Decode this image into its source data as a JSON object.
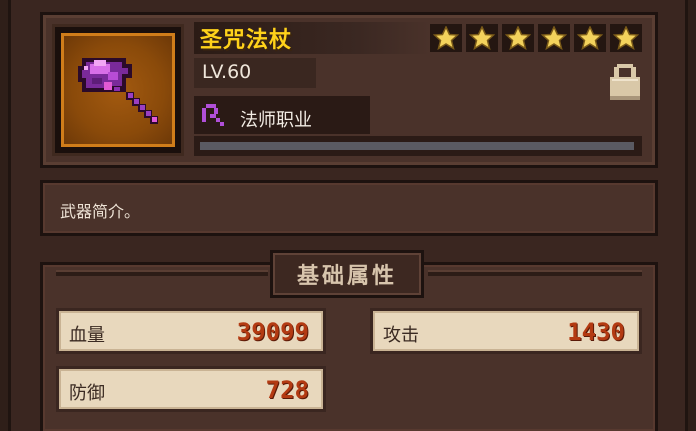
{
  "item": {
    "name": "圣咒法杖",
    "level": "LV.60",
    "stars": 6,
    "class_label": "法师职业",
    "description": "武器简介。",
    "progress": 1.0
  },
  "attributes": {
    "title": "基础属性",
    "hp_label": "血量",
    "hp_value": "39099",
    "atk_label": "攻击",
    "atk_value": "1430",
    "def_label": "防御",
    "def_value": "728"
  },
  "icons": {
    "item": "magic-staff-icon",
    "star": "star-icon",
    "lock": "lock-icon",
    "class": "mage-class-icon"
  },
  "colors": {
    "name": "#ffd21a",
    "star": "#f3d25c",
    "stat_value": "#b33a12",
    "frame_orange": "#d07d1a",
    "class_purple": "#b04fd8"
  }
}
